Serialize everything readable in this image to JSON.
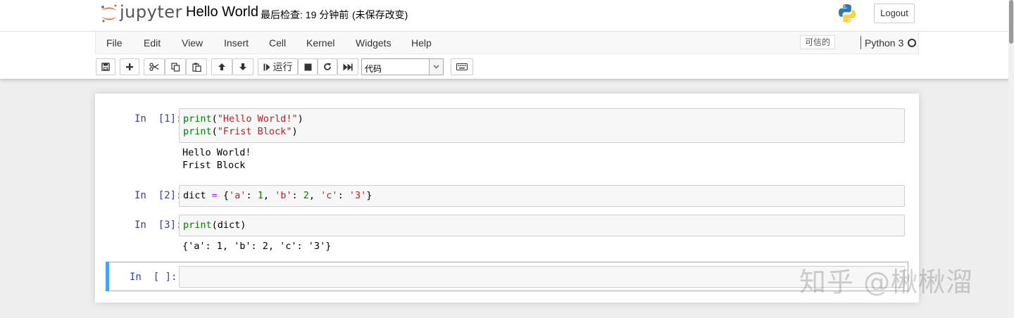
{
  "header": {
    "logo_text": "jupyter",
    "notebook_name": "Hello World",
    "checkpoint": "最后检查: 19 分钟前",
    "unsaved": "(未保存改变)",
    "logout_label": "Logout"
  },
  "menubar": {
    "items": [
      "File",
      "Edit",
      "View",
      "Insert",
      "Cell",
      "Kernel",
      "Widgets",
      "Help"
    ],
    "trusted_label": "可信的",
    "kernel_name": "Python 3"
  },
  "toolbar": {
    "run_label": "运行",
    "cell_type": "代码",
    "icons": [
      "save-icon",
      "plus-icon",
      "scissors-icon",
      "copy-icon",
      "paste-icon",
      "arrow-up-icon",
      "arrow-down-icon",
      "step-forward-icon",
      "stop-icon",
      "restart-icon",
      "fast-forward-icon",
      "chevron-down-icon",
      "keyboard-icon"
    ]
  },
  "cells": [
    {
      "prompt": "In  [1]:",
      "code": [
        "print(\"Hello World!\")",
        "print(\"Frist Block\")"
      ],
      "output": [
        "Hello World!",
        "Frist Block"
      ]
    },
    {
      "prompt": "In  [2]:",
      "code": [
        "dict = {'a': 1, 'b': 2, 'c': '3'}"
      ],
      "output": []
    },
    {
      "prompt": "In  [3]:",
      "code": [
        "print(dict)"
      ],
      "output": [
        "{'a': 1, 'b': 2, 'c': '3'}"
      ]
    },
    {
      "prompt": "In  [ ]:",
      "code": [],
      "output": []
    }
  ],
  "watermark": "知乎 @楸楸溜",
  "colors": {
    "prompt": "#303f9f",
    "builtin": "#008000",
    "string": "#ba2121",
    "operator": "#aa22ff",
    "active_cell_bar": "#42a5f5",
    "logo_orange": "#f37626"
  }
}
